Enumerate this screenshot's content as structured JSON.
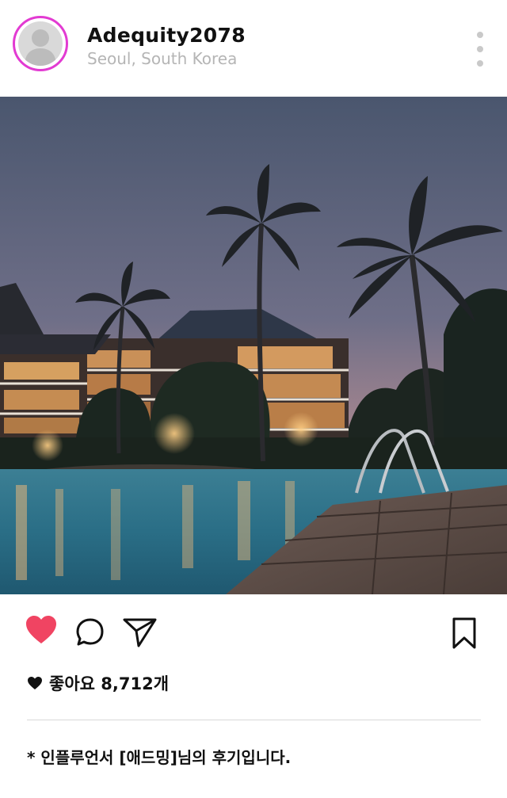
{
  "profile": {
    "username": "Adequity2078",
    "location": "Seoul, South Korea",
    "avatar_ring_color": "#e23bd2"
  },
  "menu": {
    "icon": "more-vertical-icon"
  },
  "photo": {
    "subject": "resort-pool-at-dusk"
  },
  "actions": {
    "like_icon": "heart-filled-icon",
    "like_color": "#f04462",
    "comment_icon": "comment-bubble-icon",
    "share_icon": "paper-plane-icon",
    "bookmark_icon": "bookmark-icon"
  },
  "likes": {
    "text": "좋아요 8,712개",
    "icon": "heart-small-icon"
  },
  "caption": {
    "text": "* 인플루언서 [애드밍]님의 후기입니다."
  }
}
